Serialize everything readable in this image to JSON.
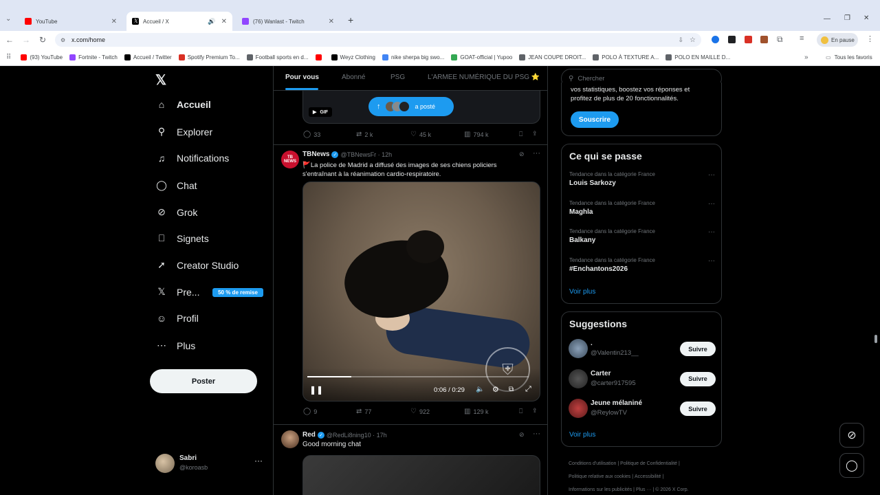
{
  "browser": {
    "tabs": [
      {
        "label": "YouTube",
        "active": false,
        "color": "#ff0000"
      },
      {
        "label": "Accueil / X",
        "active": true,
        "color": "#000000"
      },
      {
        "label": "(76) Wanlast - Twitch",
        "active": false,
        "color": "#9146ff"
      }
    ],
    "url": "x.com/home",
    "profile_status": "En pause",
    "bookmarks": [
      {
        "label": "(93) YouTube",
        "color": "#ff0000"
      },
      {
        "label": "Fortnite - Twitch",
        "color": "#9146ff"
      },
      {
        "label": "Accueil / Twitter",
        "color": "#000000"
      },
      {
        "label": "Spotify Premium To...",
        "color": "#d93025"
      },
      {
        "label": "Football sports en d...",
        "color": "#5f6368"
      },
      {
        "label": "",
        "color": "#ff0000"
      },
      {
        "label": "Weyz Clothing",
        "color": "#000000"
      },
      {
        "label": "nike sherpa big swo...",
        "color": "#4285f4"
      },
      {
        "label": "GOAT-official | Yupoo",
        "color": "#34a853"
      },
      {
        "label": "JEAN COUPE DROIT...",
        "color": "#5f6368"
      },
      {
        "label": "POLO À TEXTURE A...",
        "color": "#5f6368"
      },
      {
        "label": "POLO EN MAILLE D...",
        "color": "#5f6368"
      }
    ],
    "all_bookmarks": "Tous les favoris"
  },
  "nav": {
    "items": [
      {
        "label": "Accueil",
        "icon": "home-icon",
        "glyph": "⌂"
      },
      {
        "label": "Explorer",
        "icon": "search-icon",
        "glyph": "⚲"
      },
      {
        "label": "Notifications",
        "icon": "bell-icon",
        "glyph": "♫"
      },
      {
        "label": "Chat",
        "icon": "chat-icon",
        "glyph": "◯"
      },
      {
        "label": "Grok",
        "icon": "grok-icon",
        "glyph": "⊘"
      },
      {
        "label": "Signets",
        "icon": "bookmark-icon",
        "glyph": "⎕"
      },
      {
        "label": "Creator Studio",
        "icon": "rocket-icon",
        "glyph": "➚"
      },
      {
        "label": "Pre...",
        "icon": "x-logo-icon",
        "glyph": "𝕏"
      },
      {
        "label": "Profil",
        "icon": "profile-icon",
        "glyph": "☺"
      },
      {
        "label": "Plus",
        "icon": "more-icon",
        "glyph": "⋯"
      }
    ],
    "premium_badge": "50 % de remise",
    "post_button": "Poster",
    "user": {
      "name": "Sabri",
      "handle": "@koroasb"
    }
  },
  "feed": {
    "tabs": [
      "Pour vous",
      "Abonné",
      "PSG",
      "L'ARMEE NUMÉRIQUE DU PSG ⭐"
    ],
    "new_posts_pill": "a posté",
    "gif_label": "GIF",
    "tweet0_stats": {
      "replies": "33",
      "reposts": "2 k",
      "likes": "45 k",
      "views": "794 k"
    },
    "tweet1": {
      "name": "TBNews",
      "handle": "@TBNewsFr · 12h",
      "avatar_text": "TB NEWS",
      "text": "🚩La police de Madrid a diffusé des images de ses chiens policiers s'entraînant à la réanimation cardio-respiratoire.",
      "video_time": "0:06 / 0:29",
      "video_progress": 0.2,
      "stats": {
        "replies": "9",
        "reposts": "77",
        "likes": "922",
        "views": "129 k"
      }
    },
    "tweet2": {
      "name": "Red",
      "handle": "@RedLi8ning10 · 17h",
      "text": "Good morning chat"
    }
  },
  "sidebar": {
    "search_placeholder": "Chercher",
    "premium_text": "vos statistiques, boostez vos réponses et profitez de plus de 20 fonctionnalités.",
    "subscribe": "Souscrire",
    "trends_title": "Ce qui se passe",
    "trends": [
      {
        "category": "Tendance dans la catégorie France",
        "name": "Louis Sarkozy"
      },
      {
        "category": "Tendance dans la catégorie France",
        "name": "Maghla"
      },
      {
        "category": "Tendance dans la catégorie France",
        "name": "Balkany"
      },
      {
        "category": "Tendance dans la catégorie France",
        "name": "#Enchantons2026"
      }
    ],
    "see_more": "Voir plus",
    "suggestions_title": "Suggestions",
    "suggestions": [
      {
        "name": ".",
        "handle": "@Valentin213__",
        "follow": "Suivre"
      },
      {
        "name": "Carter",
        "handle": "@carter917595",
        "follow": "Suivre"
      },
      {
        "name": "Jeune mélaniné",
        "handle": "@ReylowTV",
        "follow": "Suivre"
      }
    ],
    "footer": [
      "Conditions d'utilisation",
      "Politique de Confidentialité",
      "Politique relative aux cookies",
      "Accessibilité",
      "Informations sur les publicités",
      "Plus ···",
      "© 2026 X Corp."
    ]
  }
}
